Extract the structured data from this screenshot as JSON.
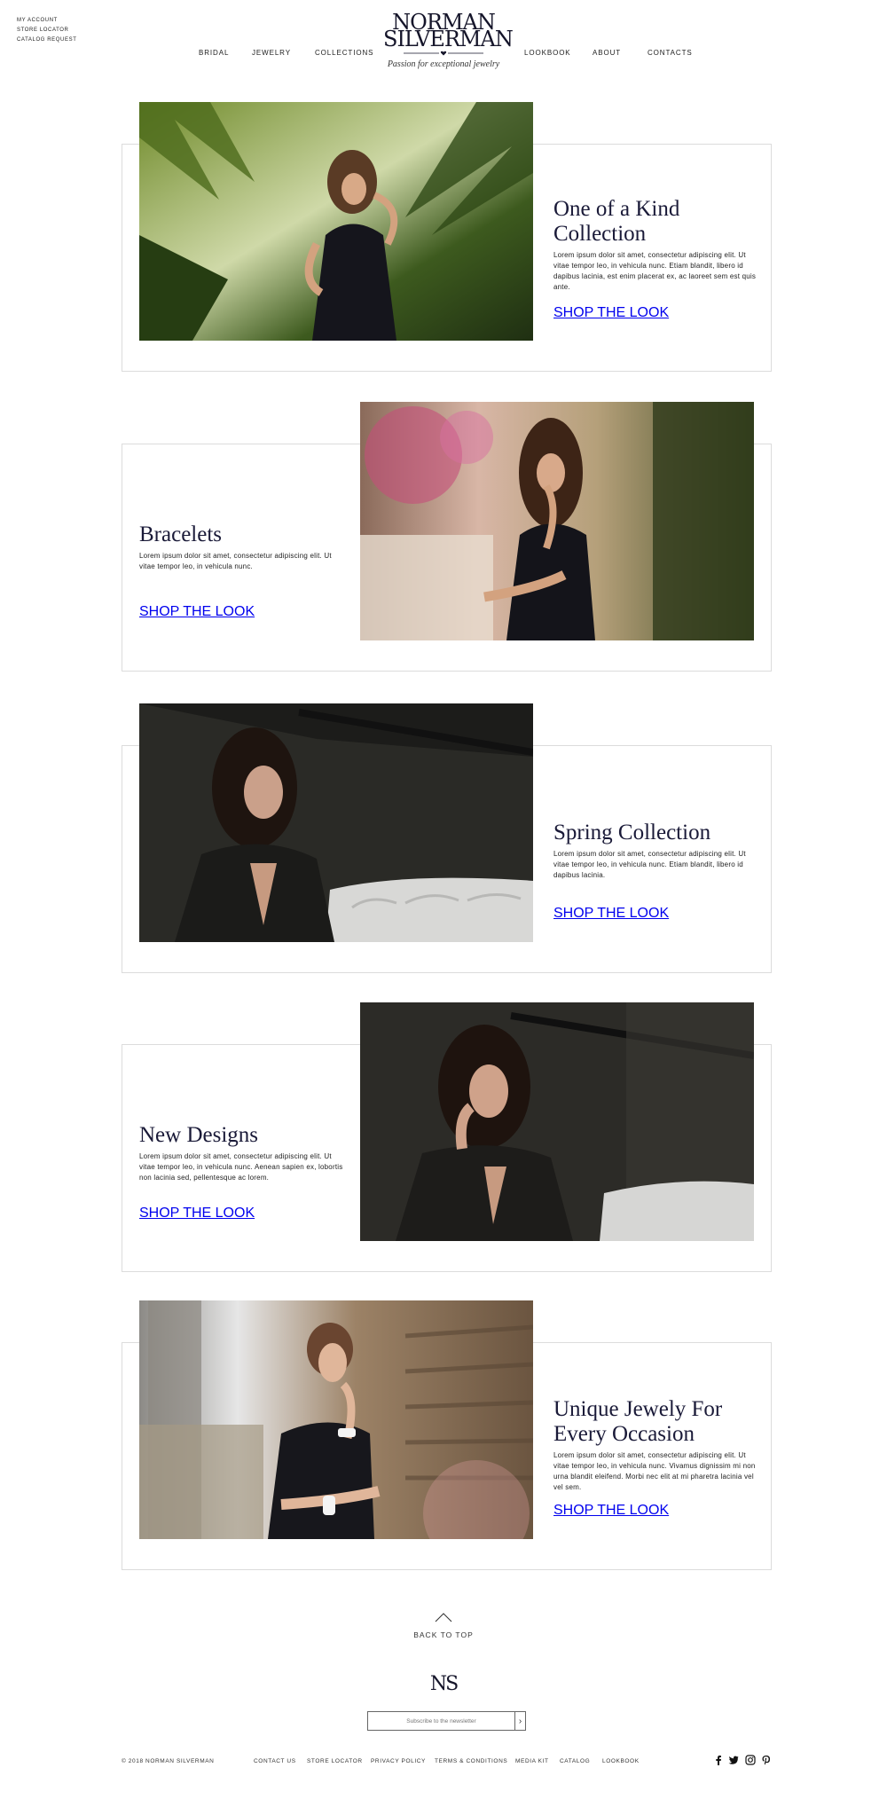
{
  "utility_links": [
    "MY ACCOUNT",
    "STORE LOCATOR",
    "CATALOG REQUEST"
  ],
  "nav_left": [
    "BRIDAL",
    "JEWELRY",
    "COLLECTIONS"
  ],
  "nav_right": [
    "LOOKBOOK",
    "ABOUT",
    "CONTACTS"
  ],
  "logo": {
    "line1": "NORMAN",
    "line2": "SILVERMAN",
    "tagline": "Passion for exceptional jewelry"
  },
  "features": [
    {
      "title": "One of a Kind Collection",
      "body": "Lorem ipsum dolor sit amet, consectetur adipiscing elit. Ut vitae tempor leo, in vehicula nunc. Etiam blandit, libero id dapibus lacinia, est enim placerat ex, ac laoreet sem est quis ante.",
      "cta": "SHOP THE LOOK"
    },
    {
      "title": "Bracelets",
      "body": "Lorem ipsum dolor sit amet, consectetur adipiscing elit. Ut vitae tempor leo, in vehicula nunc.",
      "cta": "SHOP THE LOOK"
    },
    {
      "title": "Spring Collection",
      "body": "Lorem ipsum dolor sit amet, consectetur adipiscing elit. Ut vitae tempor leo, in vehicula nunc. Etiam blandit, libero id dapibus lacinia.",
      "cta": "SHOP THE LOOK"
    },
    {
      "title": "New Designs",
      "body": "Lorem ipsum dolor sit amet, consectetur adipiscing elit. Ut vitae tempor leo, in vehicula nunc. Aenean sapien ex, lobortis non lacinia sed, pellentesque ac lorem.",
      "cta": "SHOP THE LOOK"
    },
    {
      "title": "Unique Jewely For Every Occasion",
      "body": "Lorem ipsum dolor sit amet, consectetur adipiscing elit. Ut vitae tempor leo, in vehicula nunc. Vivamus dignissim mi non urna blandit eleifend. Morbi nec elit at mi pharetra lacinia vel vel sem.",
      "cta": "SHOP THE LOOK"
    }
  ],
  "back_to_top": "BACK TO TOP",
  "monogram": "NS",
  "newsletter_placeholder": "Subscribe to the newsletter",
  "copyright": "© 2018 NORMAN SILVERMAN",
  "footer_links": [
    "CONTACT US",
    "STORE LOCATOR",
    "PRIVACY POLICY",
    "TERMS & CONDITIONS",
    "MEDIA KIT",
    "CATALOG",
    "LOOKBOOK"
  ],
  "social_icons": [
    "facebook-icon",
    "twitter-icon",
    "instagram-icon",
    "pinterest-icon"
  ],
  "colors": {
    "accent": "#1a1a38",
    "border": "#dcdcdc"
  }
}
